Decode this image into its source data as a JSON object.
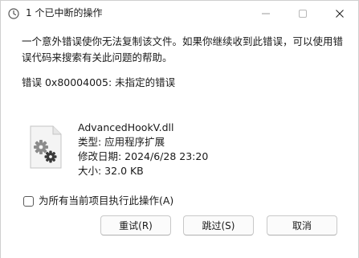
{
  "window": {
    "title": "1 个已中断的操作",
    "icons": {
      "title": "clock-icon",
      "minimize": "minimize-icon",
      "maximize": "maximize-icon",
      "close": "close-icon"
    }
  },
  "message": "一个意外错误使你无法复制该文件。如果你继续收到此错误，可以使用错误代码来搜索有关此问题的帮助。",
  "error_line": "错误 0x80004005: 未指定的错误",
  "file": {
    "icon": "gear-file-icon",
    "name": "AdvancedHookV.dll",
    "type": "类型: 应用程序扩展",
    "modified": "修改日期: 2024/6/28 23:20",
    "size": "大小: 32.0 KB"
  },
  "apply_all": {
    "label": "为所有当前项目执行此操作(A)",
    "checked": false
  },
  "buttons": {
    "retry": "重试(R)",
    "skip": "跳过(S)",
    "cancel": "取消"
  }
}
